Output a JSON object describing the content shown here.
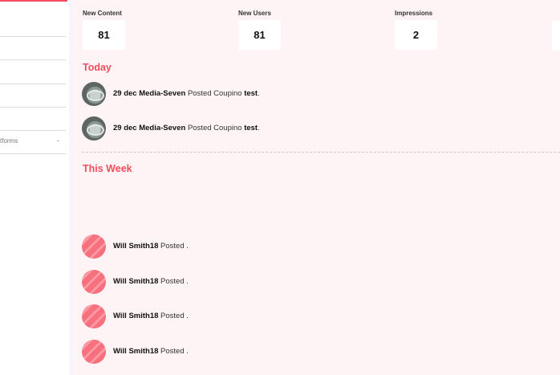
{
  "sidebar": {
    "items": [
      {
        "label": "",
        "caret": ""
      },
      {
        "label": "",
        "caret": ""
      },
      {
        "label": "",
        "caret": ""
      },
      {
        "label": "",
        "caret": ""
      },
      {
        "label": "",
        "caret": ""
      },
      {
        "label": "tforms",
        "caret": "-"
      }
    ]
  },
  "stats": [
    {
      "label": "New Content",
      "value": "81"
    },
    {
      "label": "New Users",
      "value": "81"
    },
    {
      "label": "Impressions",
      "value": "2"
    }
  ],
  "today": {
    "title": "Today",
    "items": [
      {
        "user": "29 dec Media-Seven",
        "action": "Posted Coupino",
        "target": "test",
        "suffix": "."
      },
      {
        "user": "29 dec Media-Seven",
        "action": "Posted Coupino",
        "target": "test",
        "suffix": "."
      }
    ]
  },
  "this_week": {
    "title": "This Week",
    "items": [
      {
        "user": "Will Smith18",
        "action": "Posted",
        "suffix": "."
      },
      {
        "user": "Will Smith18",
        "action": "Posted",
        "suffix": "."
      },
      {
        "user": "Will Smith18",
        "action": "Posted",
        "suffix": "."
      },
      {
        "user": "Will Smith18",
        "action": "Posted",
        "suffix": "."
      }
    ]
  },
  "colors": {
    "accent": "#f04e5e",
    "background": "#fff4f5"
  },
  "icons": {
    "today_avatar": "user-photo-avatar",
    "week_avatar": "pink-striped-avatar"
  }
}
